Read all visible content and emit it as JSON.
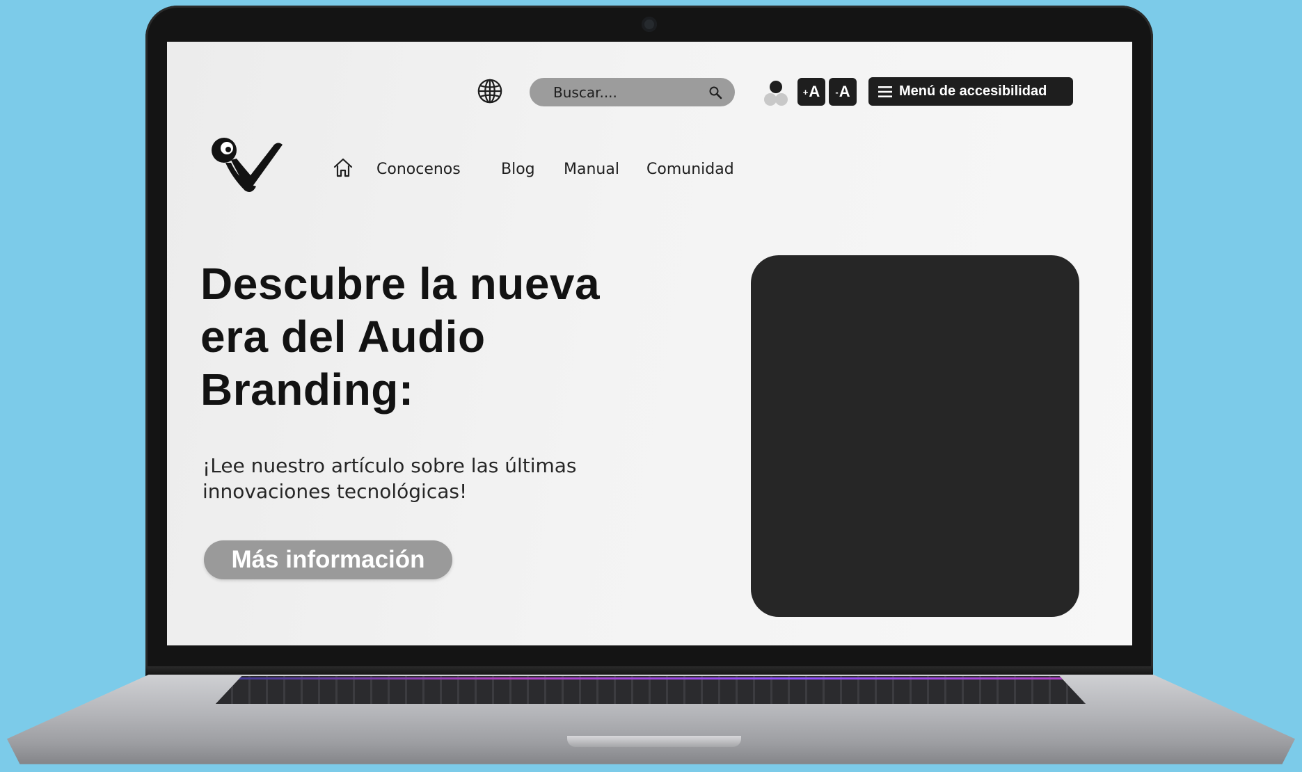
{
  "search": {
    "placeholder": "Buscar...."
  },
  "accessibility": {
    "font_increase_label": "A",
    "font_decrease_label": "A",
    "menu_label": "Menú de accesibilidad"
  },
  "nav": {
    "items": [
      {
        "label": "Conocenos"
      },
      {
        "label": "Blog"
      },
      {
        "label": "Manual"
      },
      {
        "label": "Comunidad"
      }
    ]
  },
  "hero": {
    "title_lines": [
      "Descubre la nueva",
      "era del Audio",
      "Branding:"
    ],
    "subtitle_lines": [
      "¡Lee nuestro artículo sobre las últimas",
      "innovaciones tecnológicas!"
    ],
    "cta_label": "Más información"
  },
  "icons": [
    "globe-icon",
    "search-icon",
    "contrast-icon",
    "menu-icon",
    "home-icon",
    "brand-logo"
  ],
  "colors": {
    "background": "#7ccbe9",
    "screen": "#f2f2f2",
    "dark": "#1e1e1e",
    "search_pill": "#9c9c9c",
    "cta": "#9a9a9a",
    "media_block": "#262626"
  }
}
